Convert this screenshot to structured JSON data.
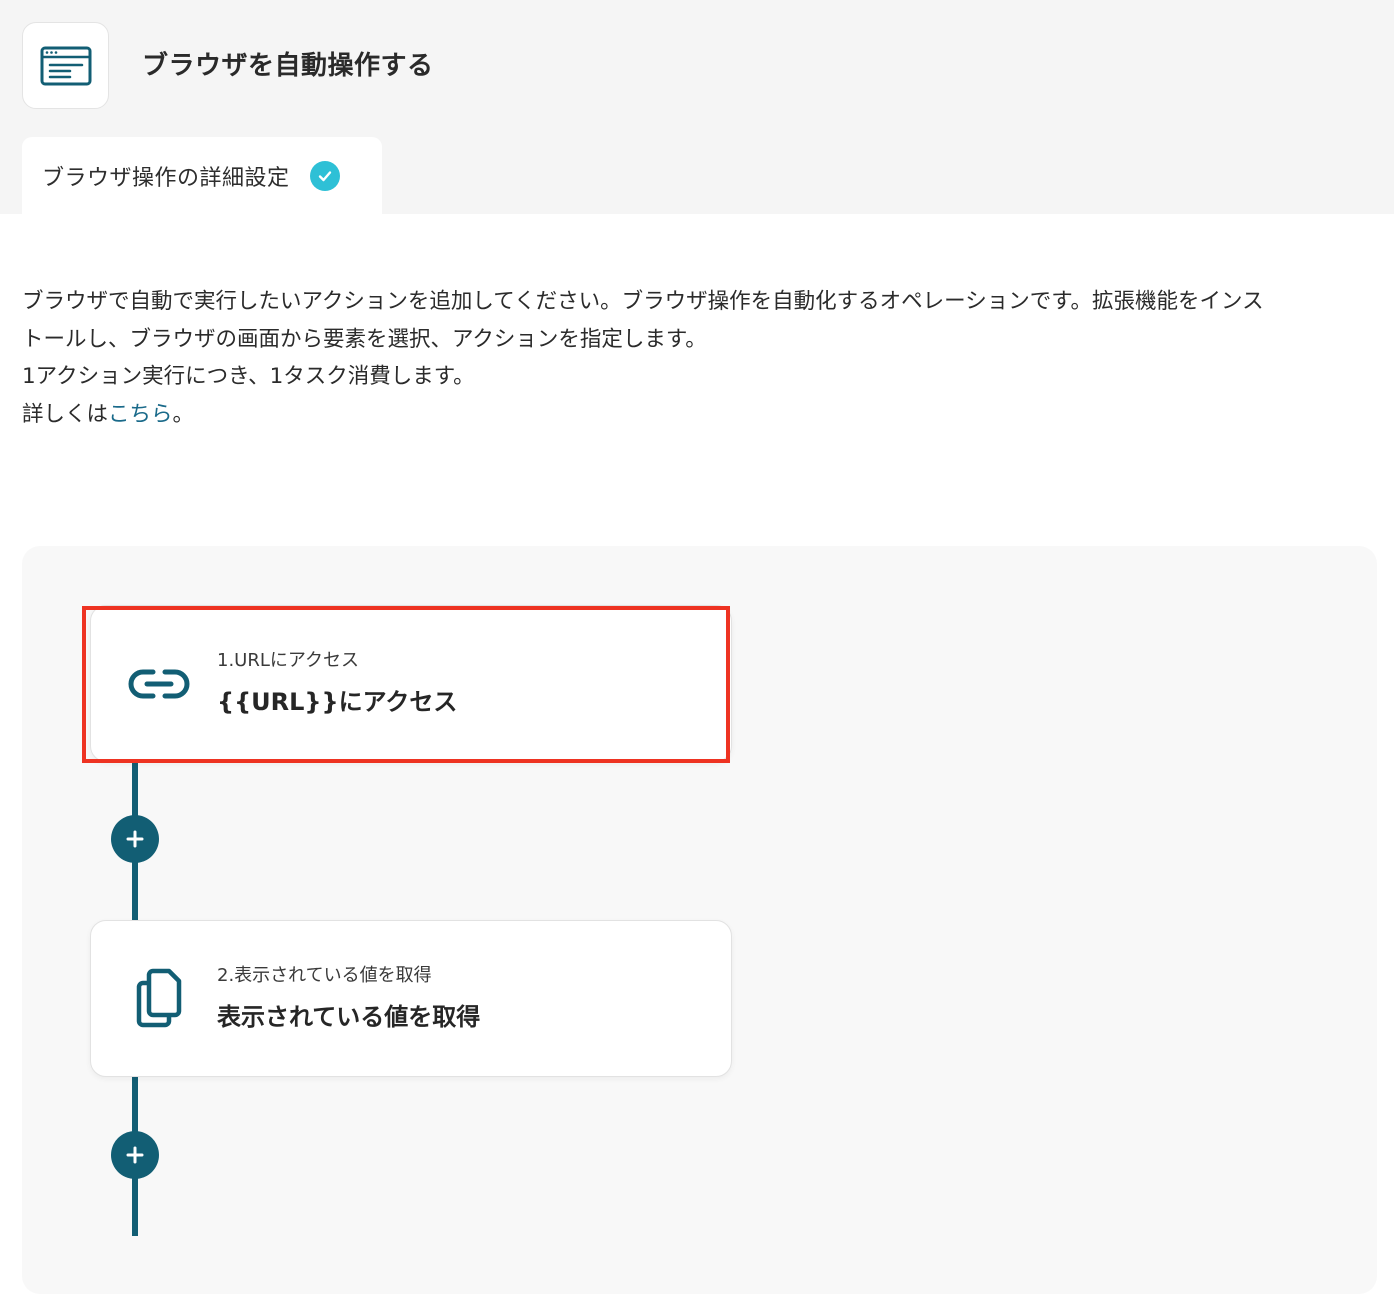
{
  "header": {
    "title": "ブラウザを自動操作する",
    "app_icon": "browser-window-icon"
  },
  "tabs": [
    {
      "label": "ブラウザ操作の詳細設定",
      "status_icon": "check-circle-icon",
      "status_color": "#2ec0d6"
    }
  ],
  "description": {
    "line1": "ブラウザで自動で実行したいアクションを追加してください。ブラウザ操作を自動化するオペレーションです。拡張機能をインス",
    "line2": "トールし、ブラウザの画面から要素を選択、アクションを指定します。",
    "line3": "1アクション実行につき、1タスク消費します。",
    "line4_prefix": "詳しくは",
    "line4_link": "こちら",
    "line4_suffix": "。"
  },
  "steps": [
    {
      "subtitle": "1.URLにアクセス",
      "title": "{{URL}}にアクセス",
      "icon": "link-icon",
      "highlighted": true
    },
    {
      "subtitle": "2.表示されている値を取得",
      "title": "表示されている値を取得",
      "icon": "copy-icon",
      "highlighted": false
    }
  ],
  "colors": {
    "accent": "#125e74",
    "link": "#1a6a8a",
    "highlight": "#ee3322",
    "check": "#2ec0d6"
  }
}
